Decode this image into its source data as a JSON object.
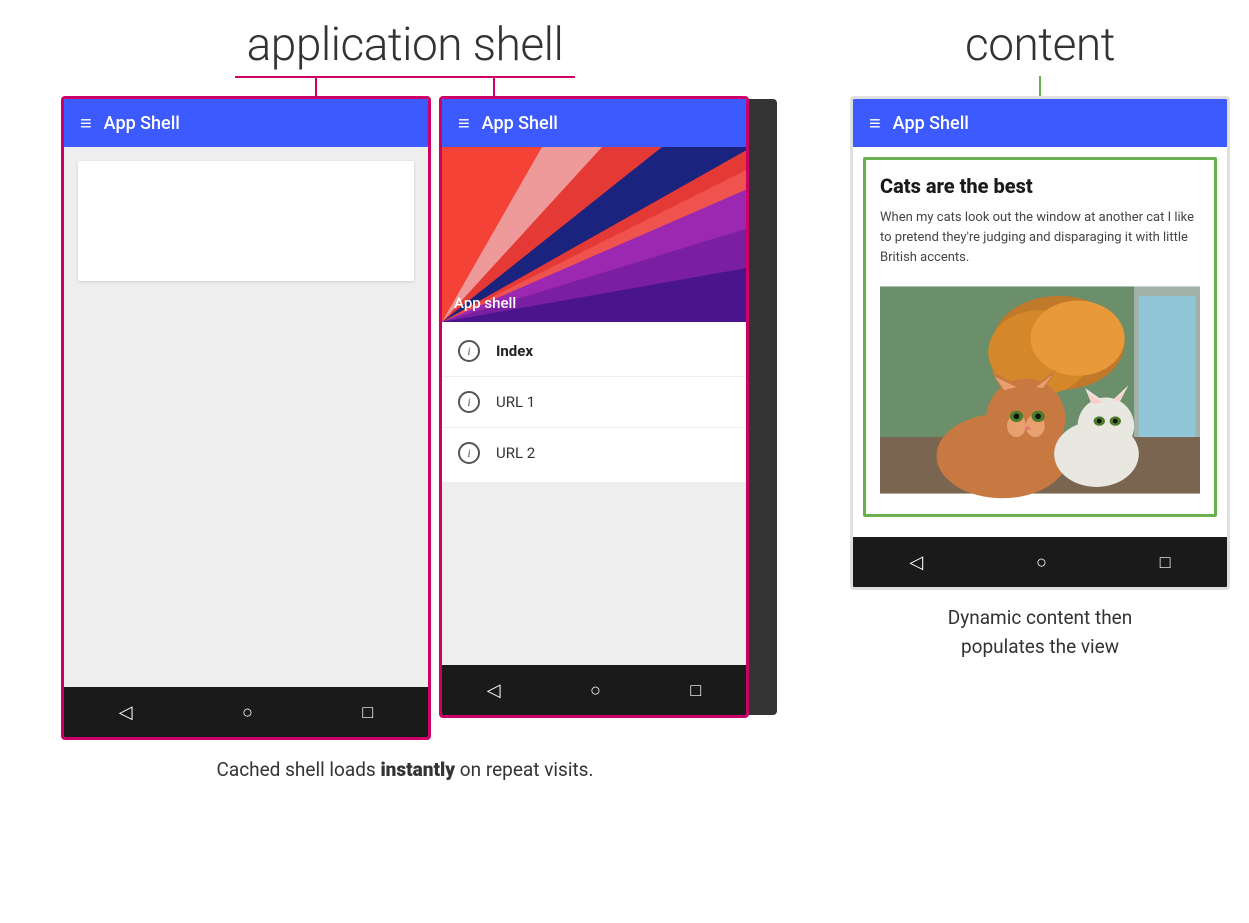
{
  "labels": {
    "application_shell": "application shell",
    "content": "content"
  },
  "phone1": {
    "toolbar_title": "App Shell",
    "hamburger": "≡"
  },
  "phone2": {
    "toolbar_title": "App Shell",
    "hamburger": "≡",
    "drawer_app_label": "App shell",
    "drawer_items": [
      {
        "label": "Index",
        "active": true
      },
      {
        "label": "URL 1",
        "active": false
      },
      {
        "label": "URL 2",
        "active": false
      }
    ]
  },
  "phone3": {
    "toolbar_title": "App Shell",
    "hamburger": "≡",
    "content_title": "Cats are the best",
    "content_text": "When my cats look out the window at another cat I like to pretend they're judging and disparaging it with little British accents."
  },
  "nav_bar": {
    "back": "◁",
    "home": "○",
    "square": "□"
  },
  "captions": {
    "left": "Cached shell loads ",
    "left_bold": "instantly",
    "left_end": " on repeat visits.",
    "right_line1": "Dynamic content then",
    "right_line2": "populates the view"
  }
}
